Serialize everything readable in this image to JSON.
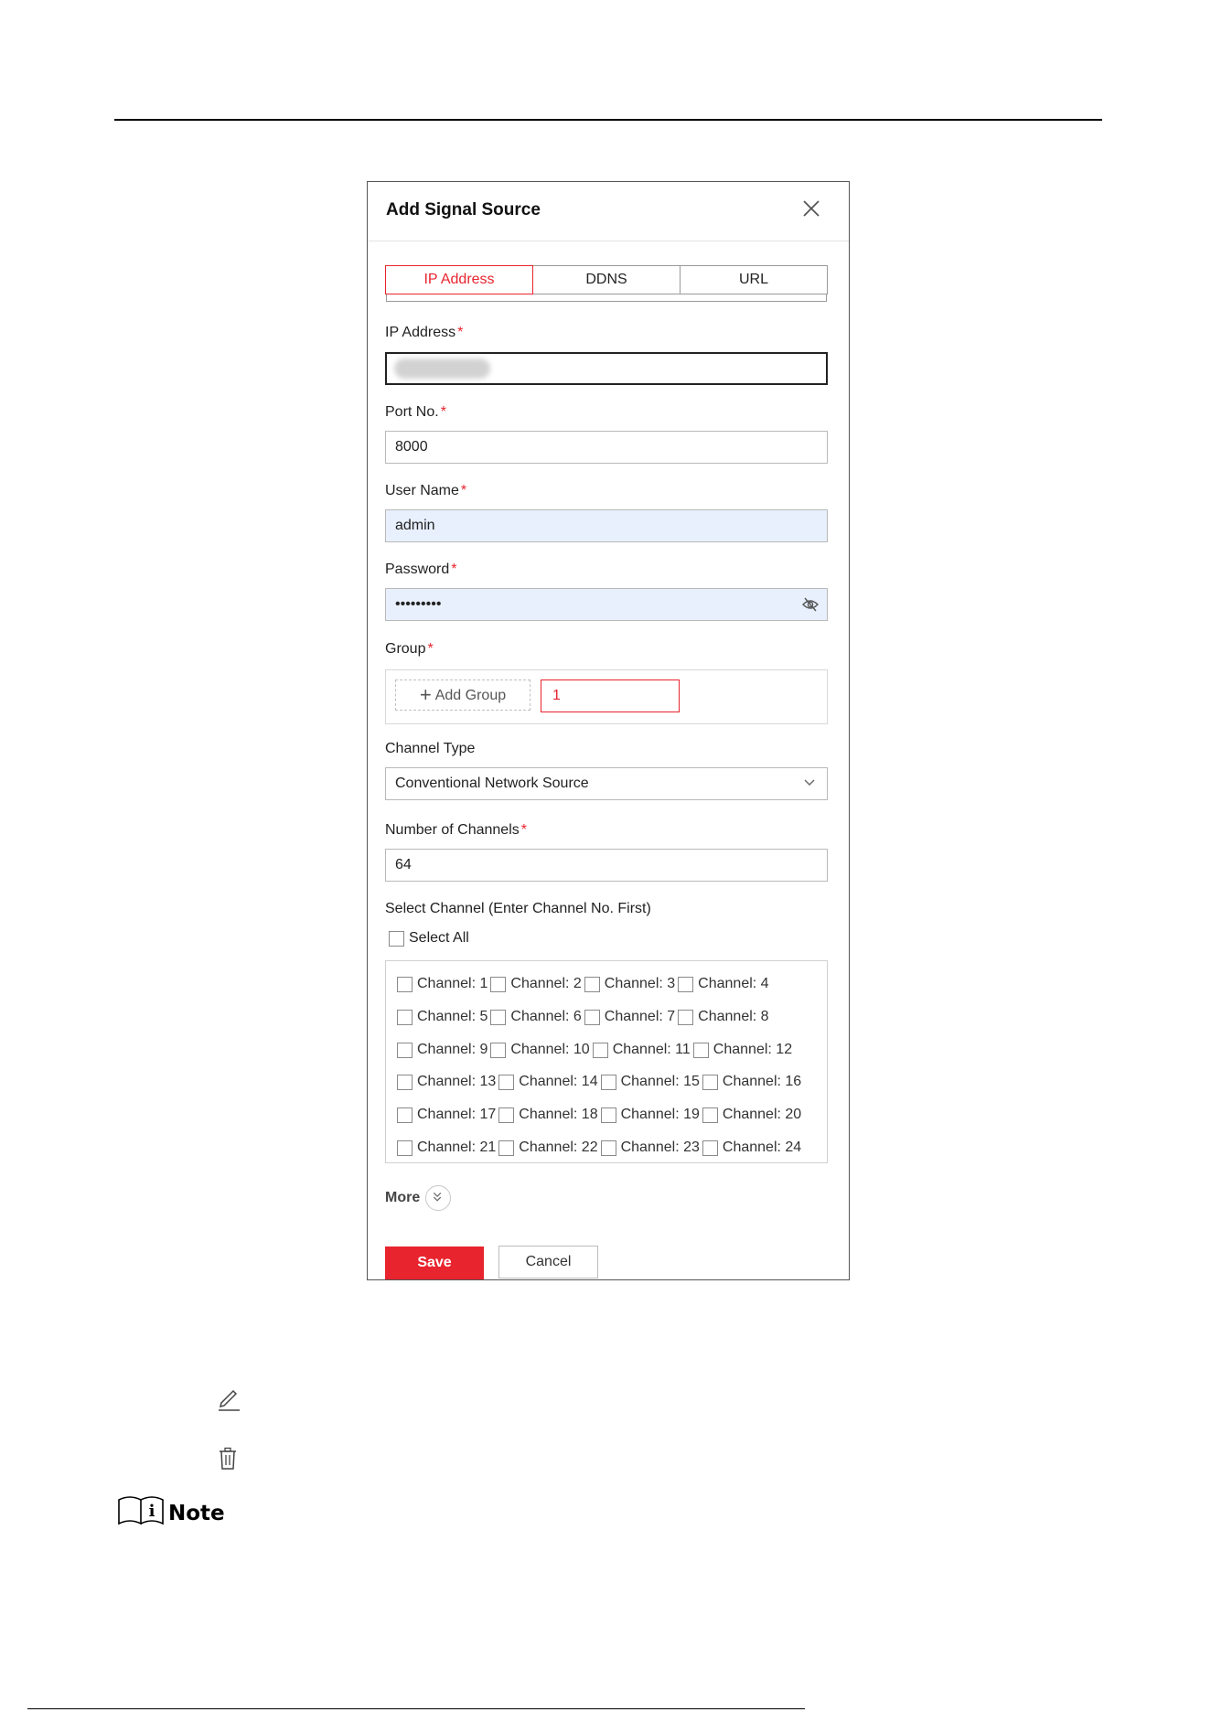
{
  "dialog": {
    "title": "Add Signal Source",
    "tabs": [
      {
        "label": "IP Address",
        "active": true
      },
      {
        "label": "DDNS",
        "active": false
      },
      {
        "label": "URL",
        "active": false
      }
    ]
  },
  "form": {
    "ip_address": {
      "label": "IP Address",
      "required": "*",
      "value": ""
    },
    "port": {
      "label": "Port No.",
      "required": "*",
      "value": "8000"
    },
    "user_name": {
      "label": "User Name",
      "required": "*",
      "value": "admin"
    },
    "password": {
      "label": "Password",
      "required": "*",
      "value": "•••••••••"
    },
    "group": {
      "label": "Group",
      "required": "*",
      "add_label": "Add Group",
      "chip": "1"
    },
    "channel_type": {
      "label": "Channel Type",
      "value": "Conventional Network Source"
    },
    "num_channels": {
      "label": "Number of Channels",
      "required": "*",
      "value": "64"
    },
    "select_channel": {
      "label": "Select Channel (Enter Channel No. First)",
      "select_all": "Select All",
      "channels": [
        "Channel: 1",
        "Channel: 2",
        "Channel: 3",
        "Channel: 4",
        "Channel: 5",
        "Channel: 6",
        "Channel: 7",
        "Channel: 8",
        "Channel: 9",
        "Channel: 10",
        "Channel: 11",
        "Channel: 12",
        "Channel: 13",
        "Channel: 14",
        "Channel: 15",
        "Channel: 16",
        "Channel: 17",
        "Channel: 18",
        "Channel: 19",
        "Channel: 20",
        "Channel: 21",
        "Channel: 22",
        "Channel: 23",
        "Channel: 24"
      ]
    },
    "more_label": "More"
  },
  "buttons": {
    "save": "Save",
    "cancel": "Cancel"
  },
  "doc": {
    "note_label": "Note"
  },
  "colors": {
    "accent": "#e8242e",
    "filled_input": "#e8f0fd"
  }
}
